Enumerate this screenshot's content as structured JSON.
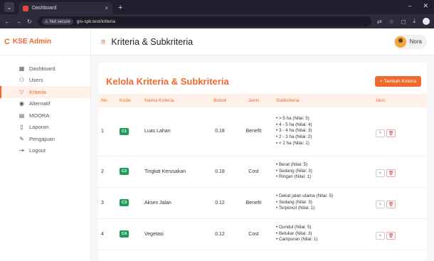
{
  "browser": {
    "tab_title": "Dashboard",
    "tab_close": "×",
    "new_tab": "+",
    "not_secure": "Not secure",
    "url": "gis-spk.test/kriteria"
  },
  "sidebar": {
    "brand": "KSE Admin",
    "items": [
      {
        "label": "Dashboard",
        "icon": "grid-icon"
      },
      {
        "label": "Users",
        "icon": "user-icon"
      },
      {
        "label": "Kriteria",
        "icon": "filter-icon",
        "active": true
      },
      {
        "label": "Alternatif",
        "icon": "map-pin-icon"
      },
      {
        "label": "MOORA",
        "icon": "calculator-icon"
      },
      {
        "label": "Laporan",
        "icon": "document-icon"
      },
      {
        "label": "Pengajuan",
        "icon": "pen-icon"
      },
      {
        "label": "Logout",
        "icon": "logout-icon"
      }
    ]
  },
  "header": {
    "title": "Kriteria & Subkriteria",
    "user_name": "Nora"
  },
  "card": {
    "title": "Kelola Kriteria & Subkriteria",
    "add_button": "+ Tambah Kriteria"
  },
  "table": {
    "columns": [
      "No",
      "Kode",
      "Nama Kriteria",
      "Bobot",
      "Jenis",
      "Subkriteria",
      "Aksi"
    ],
    "rows": [
      {
        "no": "1",
        "kode": "C1",
        "nama": "Luas Lahan",
        "bobot": "0.18",
        "jenis": "Benefit",
        "sub": [
          "> 5 ha (Nilai: 5)",
          "4 - 5 ha (Nilai: 4)",
          "3 - 4 ha (Nilai: 3)",
          "2 - 3 ha (Nilai: 2)",
          "< 2 ha (Nilai: 1)"
        ]
      },
      {
        "no": "2",
        "kode": "C2",
        "nama": "Tingkat Kerusakan",
        "bobot": "0.18",
        "jenis": "Cost",
        "sub": [
          "Berat (Nilai: 5)",
          "Sedang (Nilai: 3)",
          "Ringan (Nilai: 1)"
        ]
      },
      {
        "no": "3",
        "kode": "C3",
        "nama": "Akses Jalan",
        "bobot": "0.12",
        "jenis": "Benefit",
        "sub": [
          "Dekat jalan utama (Nilai: 5)",
          "Sedang (Nilai: 3)",
          "Terpencil (Nilai: 1)"
        ]
      },
      {
        "no": "4",
        "kode": "C4",
        "nama": "Vegetasi",
        "bobot": "0.12",
        "jenis": "Cost",
        "sub": [
          "Gundul (Nilai: 5)",
          "Belukar (Nilai: 3)",
          "Campuran (Nilai: 1)"
        ]
      }
    ]
  },
  "colors": {
    "accent": "#f06a30",
    "badge": "#1f9b5a",
    "danger": "#e03b3b"
  }
}
